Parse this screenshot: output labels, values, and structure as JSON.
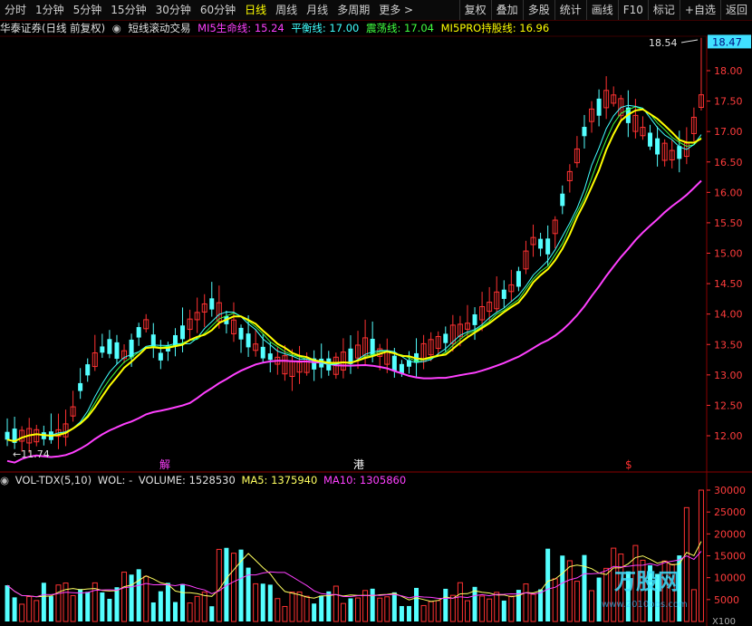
{
  "toolbar": {
    "periods": [
      "分时",
      "1分钟",
      "5分钟",
      "15分钟",
      "30分钟",
      "60分钟",
      "日线",
      "周线",
      "月线",
      "多周期",
      "更多 >"
    ],
    "active_period": "日线",
    "tools": [
      "复权",
      "叠加",
      "多股",
      "统计",
      "画线",
      "F10",
      "标记",
      "+自选",
      "返回"
    ]
  },
  "main_indicator": {
    "stock": "华泰证券(日线 前复权)",
    "formula": "短线滚动交易",
    "lines": [
      {
        "label": "MI5生命线: 15.24",
        "color": "#ff40ff"
      },
      {
        "label": "平衡线: 17.00",
        "color": "#40ffff"
      },
      {
        "label": "震荡线: 17.04",
        "color": "#40ff40"
      },
      {
        "label": "MI5PRO持股线: 16.96",
        "color": "#ffff00"
      }
    ]
  },
  "price_axis": {
    "ticks": [
      "18.00",
      "17.50",
      "17.00",
      "16.50",
      "16.00",
      "15.50",
      "15.00",
      "14.50",
      "14.00",
      "13.50",
      "13.00",
      "12.50",
      "12.00"
    ],
    "current": "18.47",
    "high_label": "18.54",
    "low_label": "11.74"
  },
  "event_markers": [
    {
      "text": "解",
      "color": "#ff40ff"
    },
    {
      "text": "港",
      "color": "#ffffff"
    },
    {
      "text": "$",
      "color": "#ff3030"
    }
  ],
  "volume_indicator": {
    "title": "VOL-TDX(5,10)",
    "wol": "WOL: -",
    "volume": "VOLUME: 1528530",
    "ma5": "MA5: 1375940",
    "ma10": "MA10: 1305860",
    "ticks": [
      "30000",
      "25000",
      "20000",
      "15000",
      "10000",
      "5000"
    ],
    "unit": "X100"
  },
  "watermark": {
    "brand": "万股网",
    "url": "www.2010bbs.com"
  },
  "colors": {
    "up": "#ff3232",
    "down": "#54ffff",
    "mi5": "#ff40ff",
    "pro": "#ffff00",
    "balance": "#40ffff",
    "osc": "#40ff40"
  }
}
